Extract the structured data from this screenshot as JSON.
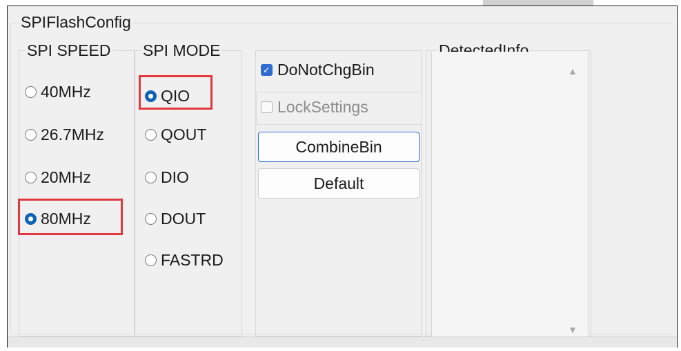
{
  "group": {
    "title": "SPIFlashConfig"
  },
  "spi_speed": {
    "title": "SPI SPEED",
    "options": [
      {
        "label": "40MHz",
        "selected": false
      },
      {
        "label": "26.7MHz",
        "selected": false
      },
      {
        "label": "20MHz",
        "selected": false
      },
      {
        "label": "80MHz",
        "selected": true
      }
    ]
  },
  "spi_mode": {
    "title": "SPI MODE",
    "options": [
      {
        "label": "QIO",
        "selected": true
      },
      {
        "label": "QOUT",
        "selected": false
      },
      {
        "label": "DIO",
        "selected": false
      },
      {
        "label": "DOUT",
        "selected": false
      },
      {
        "label": "FASTRD",
        "selected": false
      }
    ]
  },
  "options": {
    "do_not_chg_bin": {
      "label": "DoNotChgBin",
      "checked": true
    },
    "lock_settings": {
      "label": "LockSettings",
      "checked": false,
      "disabled": true
    },
    "combine_bin_label": "CombineBin",
    "default_label": "Default"
  },
  "detected_info": {
    "title": "DetectedInfo"
  },
  "icons": {
    "scroll_up": "scroll-up-arrow-icon",
    "scroll_down": "scroll-down-arrow-icon",
    "checkmark": "checkmark-icon"
  },
  "colors": {
    "radio_selected": "#0f62b5",
    "checkbox_checked": "#2f6bd1",
    "highlight": "#e0383e"
  }
}
